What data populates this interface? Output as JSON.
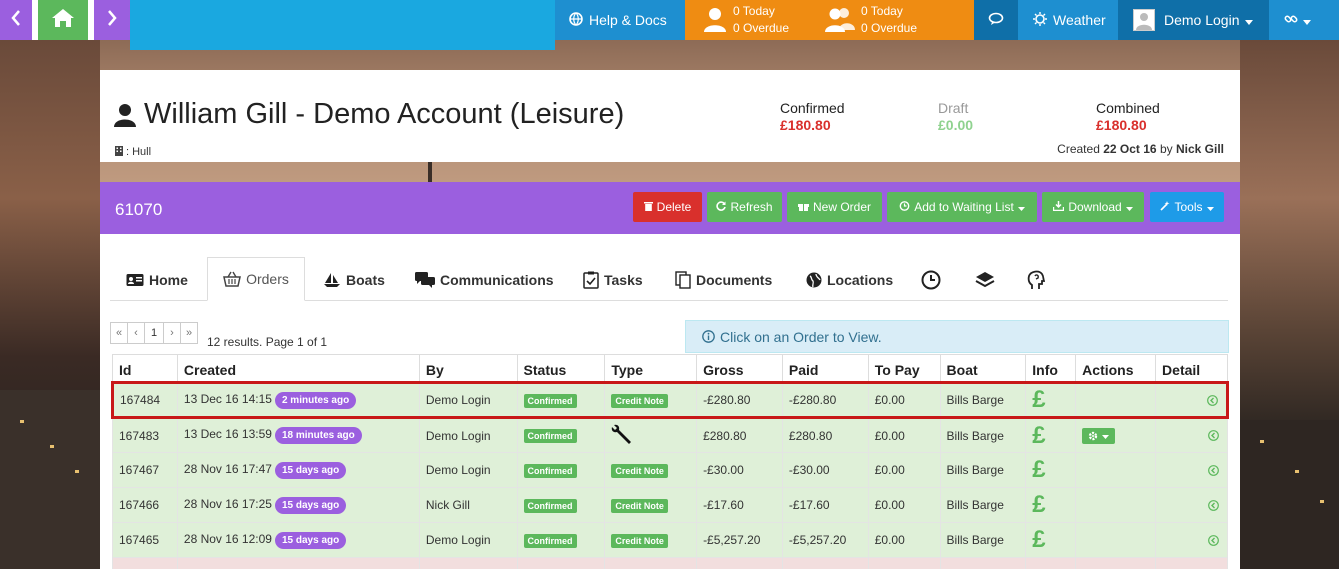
{
  "nav": {
    "help_label": "Help & Docs",
    "counter1": {
      "today": "0 Today",
      "overdue": "0 Overdue"
    },
    "counter2": {
      "today": "0 Today",
      "overdue": "0 Overdue"
    },
    "weather_label": "Weather",
    "user_label": "Demo Login",
    "colors": {
      "back": "#9b5fdf",
      "home": "#5cb85c",
      "blue": "#1e8fd0",
      "orange": "#ef8c12",
      "dark": "#0f6fa8"
    }
  },
  "account": {
    "title": "William Gill - Demo Account (Leisure)",
    "location": ": Hull",
    "confirmed_label": "Confirmed",
    "confirmed_value": "£180.80",
    "draft_label": "Draft",
    "draft_value": "£0.00",
    "combined_label": "Combined",
    "combined_value": "£180.80",
    "created_prefix": "Created",
    "created_date": "22 Oct 16",
    "created_by_prefix": "by",
    "created_by": "Nick Gill"
  },
  "panel": {
    "id": "61070",
    "buttons": {
      "delete": "Delete",
      "refresh": "Refresh",
      "new_order": "New Order",
      "waiting": "Add to Waiting List",
      "download": "Download",
      "tools": "Tools"
    }
  },
  "tabs": {
    "home": "Home",
    "orders": "Orders",
    "boats": "Boats",
    "communications": "Communications",
    "tasks": "Tasks",
    "documents": "Documents",
    "locations": "Locations"
  },
  "pagination": {
    "first": "«",
    "prev": "‹",
    "current": "1",
    "next": "›",
    "last": "»",
    "results": "12 results. Page 1 of 1"
  },
  "info_text": "Click on an Order to View.",
  "table": {
    "headers": [
      "Id",
      "Created",
      "By",
      "Status",
      "Type",
      "Gross",
      "Paid",
      "To Pay",
      "Boat",
      "Info",
      "Actions",
      "Detail"
    ],
    "rows": [
      {
        "id": "167484",
        "created": "13 Dec 16 14:15",
        "ago": "2 minutes ago",
        "by": "Demo Login",
        "status": "Confirmed",
        "type": "Credit Note",
        "gross": "-£280.80",
        "paid": "-£280.80",
        "topay": "£0.00",
        "boat": "Bills Barge",
        "info": "£"
      },
      {
        "id": "167483",
        "created": "13 Dec 16 13:59",
        "ago": "18 minutes ago",
        "by": "Demo Login",
        "status": "Confirmed",
        "type": "",
        "gross": "£280.80",
        "paid": "£280.80",
        "topay": "£0.00",
        "boat": "Bills Barge",
        "info": "£"
      },
      {
        "id": "167467",
        "created": "28 Nov 16 17:47",
        "ago": "15 days ago",
        "by": "Demo Login",
        "status": "Confirmed",
        "type": "Credit Note",
        "gross": "-£30.00",
        "paid": "-£30.00",
        "topay": "£0.00",
        "boat": "Bills Barge",
        "info": "£"
      },
      {
        "id": "167466",
        "created": "28 Nov 16 17:25",
        "ago": "15 days ago",
        "by": "Nick Gill",
        "status": "Confirmed",
        "type": "Credit Note",
        "gross": "-£17.60",
        "paid": "-£17.60",
        "topay": "£0.00",
        "boat": "Bills Barge",
        "info": "£"
      },
      {
        "id": "167465",
        "created": "28 Nov 16 12:09",
        "ago": "15 days ago",
        "by": "Demo Login",
        "status": "Confirmed",
        "type": "Credit Note",
        "gross": "-£5,257.20",
        "paid": "-£5,257.20",
        "topay": "£0.00",
        "boat": "Bills Barge",
        "info": "£"
      }
    ]
  }
}
